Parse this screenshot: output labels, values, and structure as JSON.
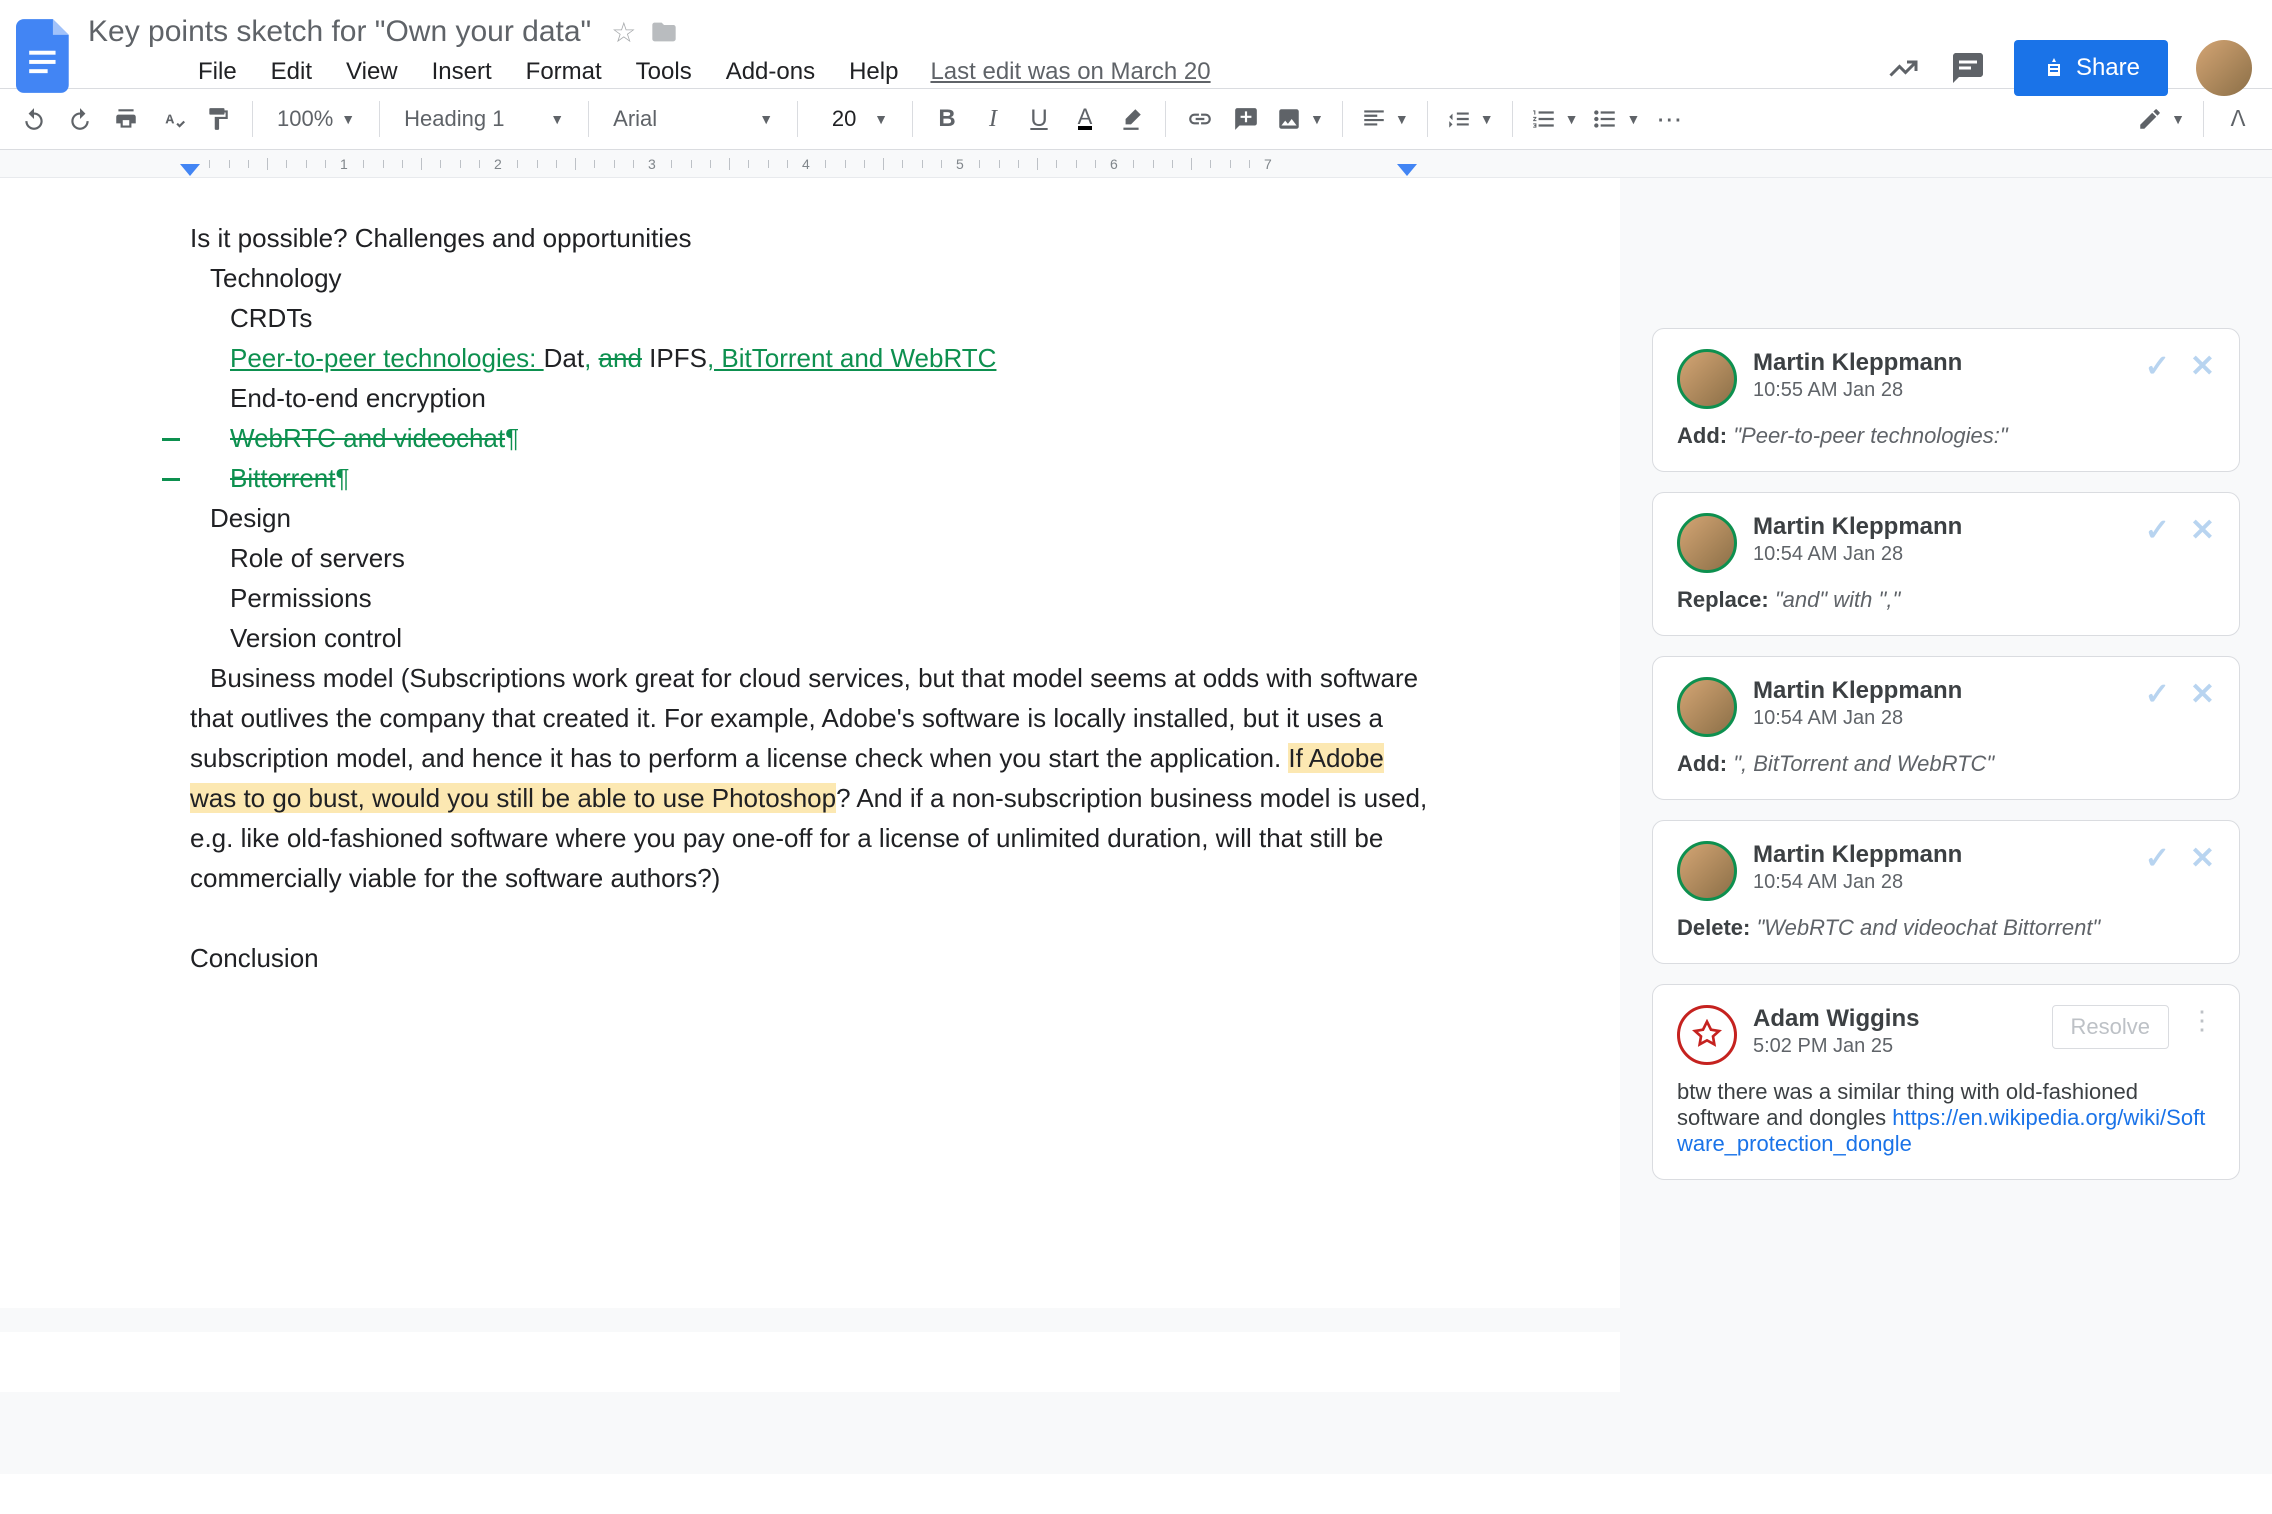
{
  "doc": {
    "title": "Key points sketch for \"Own your data\"",
    "last_edit": "Last edit was on March 20"
  },
  "menu": [
    "File",
    "Edit",
    "View",
    "Insert",
    "Format",
    "Tools",
    "Add-ons",
    "Help"
  ],
  "toolbar": {
    "zoom": "100%",
    "style": "Heading 1",
    "font": "Arial",
    "size": "20"
  },
  "share": {
    "label": "Share"
  },
  "ruler": {
    "ticks": [
      "1",
      "2",
      "3",
      "4",
      "5",
      "6",
      "7"
    ]
  },
  "content": {
    "l1": "Is it possible? Challenges and opportunities",
    "l2": "Technology",
    "l3": "CRDTs",
    "l4a": "Peer-to-peer technologies: ",
    "l4b": "Dat",
    "l4c": ", ",
    "l4d": "and",
    "l4e": " IPFS",
    "l4f": ", BitTorrent and WebRTC",
    "l5": "End-to-end encryption",
    "l6": "WebRTC and videochat",
    "l7": "Bittorrent",
    "l8": "Design",
    "l9": "Role of servers",
    "l10": "Permissions",
    "l11": "Version control",
    "bm1": "Business model (Subscriptions work great for cloud services, but that model seems at odds with software that outlives the company that created it. For example, Adobe's software is locally installed, but it uses a subscription model, and hence it has to perform a license check when you start the application. ",
    "bm_hl": "If Adobe was to go bust, would you still be able to use Photoshop",
    "bm2": "? And if a non-subscription business model is used, e.g. like old-fashioned software where you pay one-off for a license of unlimited duration, will that still be commercially viable for the software authors?)",
    "concl": "Conclusion",
    "pilcrow": "¶"
  },
  "comments": [
    {
      "author": "Martin Kleppmann",
      "time": "10:55 AM Jan 28",
      "action": "Add:",
      "text": "\"Peer-to-peer technologies:\"",
      "type": "suggestion"
    },
    {
      "author": "Martin Kleppmann",
      "time": "10:54 AM Jan 28",
      "action": "Replace:",
      "text": "\"and\" with \",\"",
      "type": "suggestion"
    },
    {
      "author": "Martin Kleppmann",
      "time": "10:54 AM Jan 28",
      "action": "Add:",
      "text": "\", BitTorrent and WebRTC\"",
      "type": "suggestion"
    },
    {
      "author": "Martin Kleppmann",
      "time": "10:54 AM Jan 28",
      "action": "Delete:",
      "text": "\"WebRTC and videochat Bittorrent\"",
      "type": "suggestion"
    },
    {
      "author": "Adam Wiggins",
      "time": "5:02 PM Jan 25",
      "body": "btw there was a similar thing with old-fashioned software and dongles ",
      "link": "https://en.wikipedia.org/wiki/Software_protection_dongle",
      "resolve": "Resolve",
      "type": "comment"
    }
  ]
}
